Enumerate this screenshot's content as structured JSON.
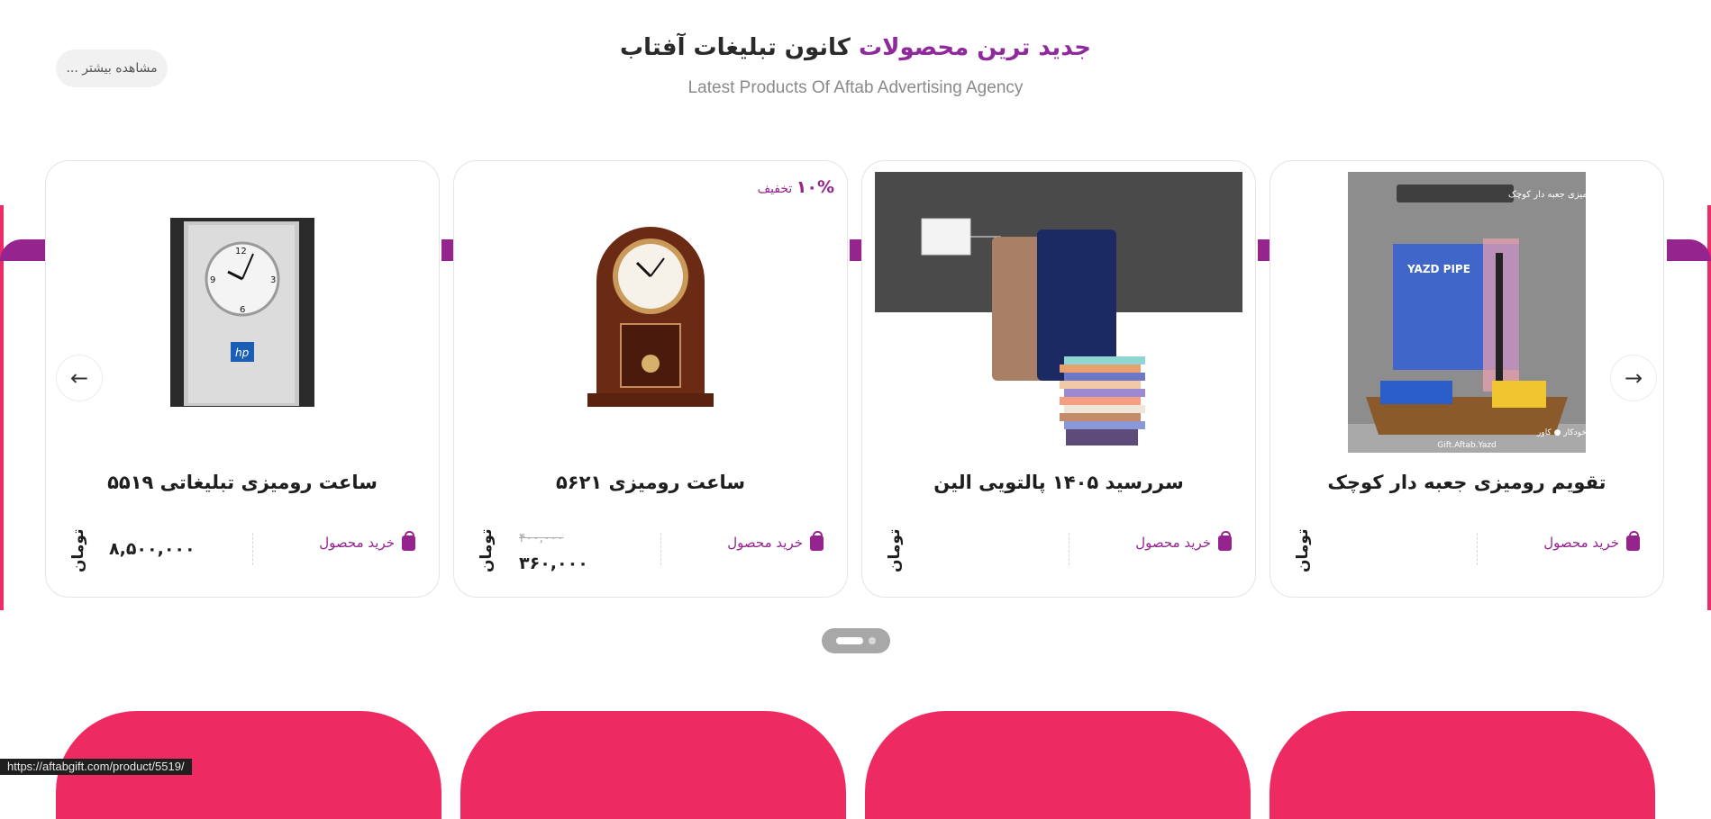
{
  "header": {
    "title_accent": "جدید ترین محصولات",
    "title_rest": "کانون تبلیغات آفتاب",
    "subtitle": "Latest Products Of Aftab Advertising Agency",
    "more_button": "مشاهده بیشتر ..."
  },
  "products": [
    {
      "title": "تقویم رومیزی جعبه دار کوچک",
      "buy_label": "خرید محصول",
      "currency": "تومان",
      "price": "",
      "image_text_top": "تقویم رومیزی جعبه دار کوچک",
      "image_text_bottom": "● همراه با یادداشت  ● جای خودکار  ● کاور",
      "image_brand": "Gift.Aftab.Yazd",
      "image_logo": "YAZD PIPE"
    },
    {
      "title": "سررسید ۱۴۰۵ پالتویی الین",
      "buy_label": "خرید محصول",
      "currency": "تومان",
      "price": ""
    },
    {
      "title": "ساعت رومیزی ۵۶۲۱",
      "buy_label": "خرید محصول",
      "currency": "تومان",
      "old_price": "۴۰۰,۰۰۰",
      "price": "۳۶۰,۰۰۰",
      "discount_value": "۱۰%",
      "discount_label": "تخفیف"
    },
    {
      "title": "ساعت رومیزی تبلیغاتی ۵۵۱۹",
      "buy_label": "خرید محصول",
      "currency": "تومان",
      "price": "۸,۵۰۰,۰۰۰",
      "image_logo": "hp"
    }
  ],
  "status_url": "https://aftabgift.com/product/5519/",
  "colors": {
    "accent_purple": "#95248f",
    "accent_pink": "#ed2a61",
    "text_dark": "#1e1e1e"
  },
  "icons": {
    "prev": "arrow-left-icon",
    "next": "arrow-right-icon",
    "buy": "shopping-bag-icon"
  }
}
